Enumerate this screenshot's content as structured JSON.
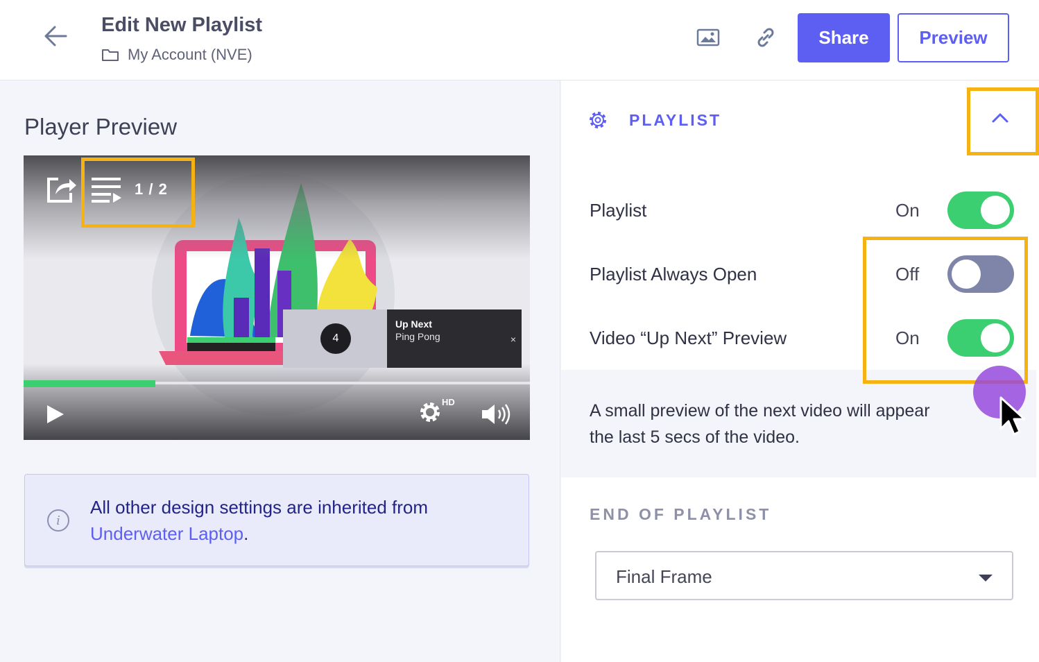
{
  "header": {
    "title": "Edit New Playlist",
    "account": "My Account (NVE)",
    "back_icon": "arrow-left-icon",
    "folder_icon": "folder-icon",
    "image_icon": "image-icon",
    "link_icon": "link-icon",
    "share_label": "Share",
    "preview_label": "Preview"
  },
  "left": {
    "title": "Player Preview",
    "player": {
      "playlist_count": "1 / 2",
      "up_next_label": "Up Next",
      "up_next_title": "Ping Pong",
      "up_next_number": "4",
      "close_label": "×",
      "hd_label": "HD",
      "progress": 0.26
    },
    "info": {
      "text": "All other design settings are inherited from",
      "link": "Underwater Laptop",
      "suffix": "."
    }
  },
  "right": {
    "section_title": "PLAYLIST",
    "settings": [
      {
        "label": "Playlist",
        "state": "On"
      },
      {
        "label": "Playlist Always Open",
        "state": "Off"
      },
      {
        "label": "Video “Up Next” Preview",
        "state": "On"
      }
    ],
    "description": "A small preview of the next video will appear",
    "description_2": "the last 5 secs of the video.",
    "end_label": "END OF PLAYLIST",
    "end_select_value": "Final Frame"
  },
  "colors": {
    "accent": "#5d5ef2",
    "toggle_on": "#3ccf71",
    "toggle_off": "#7f85a8",
    "highlight": "#f6b112",
    "cursor_dot": "#974adc"
  }
}
